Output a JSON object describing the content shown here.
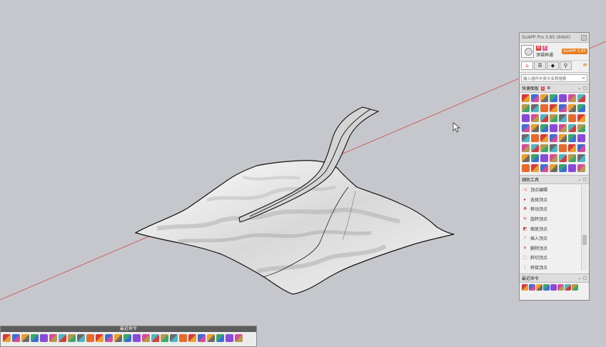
{
  "panel": {
    "title": "SUAPP Pro 3.85 (64bit)",
    "username": "添福神通",
    "version_badge": "SUAPP 3.85",
    "badge1": "N",
    "badge2": "E",
    "search_placeholder": "输入插件中英文名称搜索",
    "quick_panel_label": "快捷面板",
    "quick_panel_count": "1",
    "aux_tools_label": "辅助工具",
    "aux_items": [
      {
        "label": "顶点编辑",
        "icon": "◁"
      },
      {
        "label": "选择顶点",
        "icon": "▸"
      },
      {
        "label": "移动顶点",
        "icon": "✥"
      },
      {
        "label": "旋转顶点",
        "icon": "↻"
      },
      {
        "label": "缩放顶点",
        "icon": "◩"
      },
      {
        "label": "插入顶点",
        "icon": "⁄"
      },
      {
        "label": "删除顶点",
        "icon": "✕"
      },
      {
        "label": "斜切顶点",
        "icon": "⬚"
      },
      {
        "label": "桥接顶点",
        "icon": "⋮"
      }
    ],
    "recent_label": "最近命令"
  },
  "toolbar": {
    "title": "最近命令"
  },
  "colors": {
    "background": "#c6c7cc",
    "axis_red": "#d04848",
    "accent": "#e87d1b"
  }
}
